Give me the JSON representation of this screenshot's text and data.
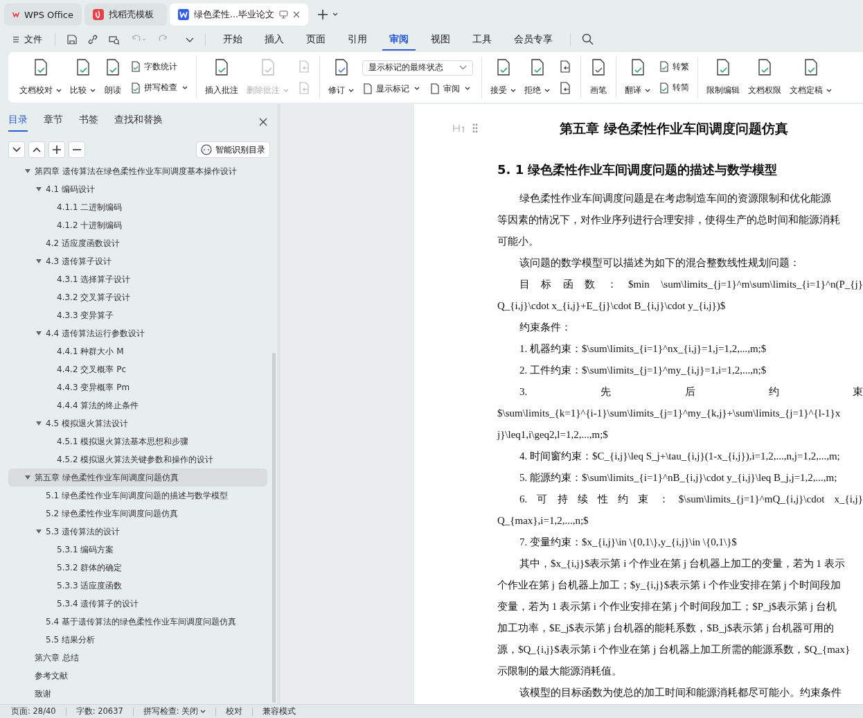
{
  "tabs": [
    {
      "kind": "wps",
      "label": "WPS Office",
      "selected": false
    },
    {
      "kind": "template",
      "label": "找稻壳模板",
      "selected": false
    },
    {
      "kind": "doc",
      "label": "绿色柔性...毕业论文",
      "selected": true
    }
  ],
  "menu": {
    "file": "文件",
    "tabs": [
      {
        "label": "开始",
        "selected": false
      },
      {
        "label": "插入",
        "selected": false
      },
      {
        "label": "页面",
        "selected": false
      },
      {
        "label": "引用",
        "selected": false
      },
      {
        "label": "审阅",
        "selected": true
      },
      {
        "label": "视图",
        "selected": false
      },
      {
        "label": "工具",
        "selected": false
      },
      {
        "label": "会员专享",
        "selected": false
      }
    ]
  },
  "ribbon": {
    "groups": [
      {
        "items": [
          {
            "kind": "large",
            "label": "文档校对",
            "dropdown": true,
            "disabled": false
          },
          {
            "kind": "large",
            "label": "比较",
            "dropdown": true,
            "disabled": false
          },
          {
            "kind": "large",
            "label": "朗读",
            "dropdown": false,
            "disabled": false
          },
          {
            "kind": "small",
            "label": "字数统计",
            "dropdown": false,
            "disabled": false
          },
          {
            "kind": "small",
            "label": "拼写检查",
            "dropdown": true,
            "disabled": false
          }
        ]
      },
      {
        "items": [
          {
            "kind": "large",
            "label": "插入批注",
            "dropdown": false,
            "disabled": false
          },
          {
            "kind": "large",
            "label": "删除批注",
            "dropdown": true,
            "disabled": true
          },
          {
            "kind": "icon",
            "disabled": true
          },
          {
            "kind": "icon",
            "disabled": true
          }
        ]
      },
      {
        "items": [
          {
            "kind": "large",
            "label": "修订",
            "dropdown": true,
            "disabled": false
          },
          {
            "kind": "select",
            "value": "显示标记的最终状态"
          },
          {
            "kind": "small",
            "label": "显示标记",
            "dropdown": true,
            "disabled": false
          },
          {
            "kind": "small",
            "label": "审阅",
            "dropdown": true,
            "disabled": false
          }
        ]
      },
      {
        "items": [
          {
            "kind": "large",
            "label": "接受",
            "dropdown": true,
            "disabled": false
          },
          {
            "kind": "large",
            "label": "拒绝",
            "dropdown": true,
            "disabled": false
          },
          {
            "kind": "icon",
            "disabled": false
          },
          {
            "kind": "icon",
            "disabled": false
          }
        ]
      },
      {
        "items": [
          {
            "kind": "large",
            "label": "画笔",
            "dropdown": false,
            "disabled": false
          }
        ]
      },
      {
        "items": [
          {
            "kind": "large",
            "label": "翻译",
            "dropdown": true,
            "disabled": false
          },
          {
            "kind": "small",
            "label": "转繁",
            "dropdown": false,
            "disabled": false
          },
          {
            "kind": "small",
            "label": "转简",
            "dropdown": false,
            "disabled": false
          }
        ]
      },
      {
        "items": [
          {
            "kind": "large",
            "label": "限制编辑",
            "dropdown": false,
            "disabled": false
          },
          {
            "kind": "large",
            "label": "文档权限",
            "dropdown": false,
            "disabled": false
          },
          {
            "kind": "large",
            "label": "文档定稿",
            "dropdown": true,
            "disabled": false
          }
        ]
      }
    ]
  },
  "sidebar": {
    "tabs": [
      {
        "label": "目录",
        "selected": true
      },
      {
        "label": "章节",
        "selected": false
      },
      {
        "label": "书签",
        "selected": false
      },
      {
        "label": "查找和替换",
        "selected": false
      }
    ],
    "smart_button": "智能识别目录",
    "toc": [
      {
        "label": "第四章  遗传算法在绿色柔性作业车间调度基本操作设计",
        "selected": false,
        "expanded": true,
        "children": [
          {
            "label": "4.1  编码设计",
            "selected": false,
            "expanded": true,
            "children": [
              {
                "label": "4.1.1 二进制编码",
                "selected": false
              },
              {
                "label": "4.1.2 十进制编码",
                "selected": false
              }
            ]
          },
          {
            "label": "4.2 适应度函数设计",
            "selected": false
          },
          {
            "label": "4.3 遗传算子设计",
            "selected": false,
            "expanded": true,
            "children": [
              {
                "label": "4.3.1 选择算子设计",
                "selected": false
              },
              {
                "label": "4.3.2  交叉算子设计",
                "selected": false
              },
              {
                "label": "4.3.3 变异算子",
                "selected": false
              }
            ]
          },
          {
            "label": "4.4 遗传算法运行参数设计",
            "selected": false,
            "expanded": true,
            "children": [
              {
                "label": "4.4.1 种群大小 M",
                "selected": false
              },
              {
                "label": "4.4.2 交叉概率 Pc",
                "selected": false
              },
              {
                "label": "4.4.3 变异概率 Pm",
                "selected": false
              },
              {
                "label": "4.4.4 算法的终止条件",
                "selected": false
              }
            ]
          },
          {
            "label": "4.5 模拟退火算法设计",
            "selected": false,
            "expanded": true,
            "children": [
              {
                "label": "4.5.1 模拟退火算法基本思想和步骤",
                "selected": false
              },
              {
                "label": "4.5.2 模拟退火算法关键参数和操作的设计",
                "selected": false
              }
            ]
          }
        ]
      },
      {
        "label": "第五章  绿色柔性作业车间调度问题仿真",
        "selected": true,
        "expanded": true,
        "children": [
          {
            "label": "5.1  绿色柔性作业车间调度问题的描述与数学模型",
            "selected": false
          },
          {
            "label": "5.2  绿色柔性作业车间调度问题仿真",
            "selected": false
          },
          {
            "label": "5.3  遗传算法的设计",
            "selected": false,
            "expanded": true,
            "children": [
              {
                "label": "5.3.1  编码方案",
                "selected": false
              },
              {
                "label": "5.3.2  群体的确定",
                "selected": false
              },
              {
                "label": "5.3.3  适应度函数",
                "selected": false
              },
              {
                "label": "5.3.4  遗传算子的设计",
                "selected": false
              }
            ]
          },
          {
            "label": "5.4  基于遗传算法的绿色柔性作业车间调度问题仿真",
            "selected": false
          },
          {
            "label": "5.5  结果分析",
            "selected": false
          }
        ]
      },
      {
        "label": "第六章  总结",
        "selected": false
      },
      {
        "label": "参考文献",
        "selected": false
      },
      {
        "label": "致谢",
        "selected": false
      }
    ]
  },
  "document": {
    "lines": [
      {
        "kind": "chapter",
        "text": "第五章  绿色柔性作业车间调度问题仿真"
      },
      {
        "kind": "section",
        "text": "5. 1  绿色柔性作业车间调度问题的描述与数学模型"
      },
      {
        "kind": "para",
        "text": "绿色柔性作业车间调度问题是在考虑制造车间的资源限制和优化能源"
      },
      {
        "kind": "cont",
        "text": "等因素的情况下，对作业序列进行合理安排，使得生产的总时间和能源消耗"
      },
      {
        "kind": "cont",
        "text": "可能小。"
      },
      {
        "kind": "para",
        "text": "该问题的数学模型可以描述为如下的混合整数线性规划问题："
      },
      {
        "kind": "spread",
        "text": "目 标 函 数 ： $min \\sum\\limits_{j=1}^m\\sum\\limits_{i=1}^n(P_{j}"
      },
      {
        "kind": "cont",
        "text": "Q_{i,j}\\cdot x_{i,j}+E_{j}\\cdot B_{i,j}\\cdot y_{i,j})$"
      },
      {
        "kind": "para",
        "text": "约束条件："
      },
      {
        "kind": "para",
        "text": "1. 机器约束：$\\sum\\limits_{i=1}^nx_{i,j}=1,j=1,2,...,m;$"
      },
      {
        "kind": "para",
        "text": "2. 工件约束：$\\sum\\limits_{j=1}^my_{i,j}=1,i=1,2,...,n;$"
      },
      {
        "kind": "spread",
        "text": "3. 先 后 约 束"
      },
      {
        "kind": "cont",
        "text": "$\\sum\\limits_{k=1}^{i-1}\\sum\\limits_{j=1}^my_{k,j}+\\sum\\limits_{j=1}^{l-1}x"
      },
      {
        "kind": "cont",
        "text": "j}\\leq1,i\\geq2,l=1,2,...,m;$"
      },
      {
        "kind": "para",
        "text": "4. 时间窗约束：$C_{i,j}\\leq S_j+\\tau_{i,j}(1-x_{i,j}),i=1,2,...,n,j=1,2,...,m;"
      },
      {
        "kind": "para",
        "text": "5. 能源约束：$\\sum\\limits_{i=1}^nB_{i,j}\\cdot y_{i,j}\\leq B_j,j=1,2,...,m;"
      },
      {
        "kind": "spread",
        "text": "6. 可 持 续 性 约 束 ： $\\sum\\limits_{j=1}^mQ_{i,j}\\cdot x_{i,j}"
      },
      {
        "kind": "cont",
        "text": "Q_{max},i=1,2,...,n;$"
      },
      {
        "kind": "para",
        "text": "7. 变量约束：$x_{i,j}\\in \\{0,1\\},y_{i,j}\\in \\{0,1\\}$"
      },
      {
        "kind": "para",
        "text": "其中，$x_{i,j}$表示第 i 个作业在第 j 台机器上加工的变量，若为 1 表示"
      },
      {
        "kind": "cont",
        "text": "个作业在第 j 台机器上加工；$y_{i,j}$表示第 i 个作业安排在第 j 个时间段加"
      },
      {
        "kind": "cont",
        "text": "变量，若为 1 表示第 i 个作业安排在第 j 个时间段加工；$P_j$表示第 j 台机"
      },
      {
        "kind": "cont",
        "text": "加工功率，$E_j$表示第 j 台机器的能耗系数，$B_j$表示第 j 台机器可用的"
      },
      {
        "kind": "cont",
        "text": "源，$Q_{i,j}$表示第 i 个作业在第 j 台机器上加工所需的能源系数，$Q_{max}"
      },
      {
        "kind": "cont",
        "text": "示限制的最大能源消耗值。"
      },
      {
        "kind": "para",
        "text": "该模型的目标函数为使总的加工时间和能源消耗都尽可能小。约束条件"
      }
    ]
  },
  "status_bar": {
    "items": [
      {
        "label": "页面: 28/40",
        "dropdown": false
      },
      {
        "label": "字数: 20637",
        "dropdown": false
      },
      {
        "label": "拼写检查: 关闭",
        "dropdown": true
      },
      {
        "label": "校对",
        "dropdown": false
      },
      {
        "label": "兼容模式",
        "dropdown": false
      }
    ]
  }
}
